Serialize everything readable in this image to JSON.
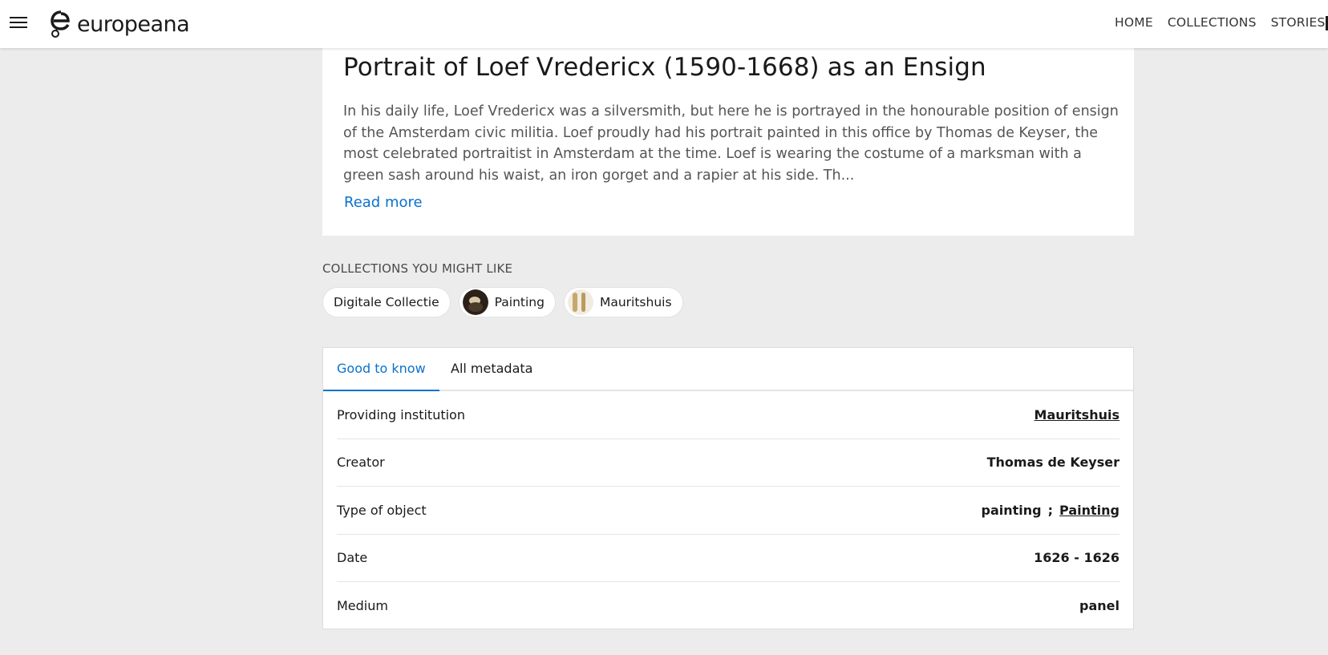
{
  "header": {
    "logo_text": "europeana",
    "nav": [
      "HOME",
      "COLLECTIONS",
      "STORIES"
    ]
  },
  "description": {
    "title": "Portrait of Loef Vredericx (1590-1668) as an Ensign",
    "text": "In his daily life, Loef Vredericx was a silversmith, but here he is portrayed in the honourable position of ensign of the Amsterdam civic militia. Loef proudly had his portrait painted in this office by Thomas de Keyser, the most celebrated portraitist in Amsterdam at the time. Loef is wearing the costume of a marksman with a green sash around his waist, an iron gorget and a rapier at his side. Th...",
    "read_more": "Read more"
  },
  "collections": {
    "heading": "COLLECTIONS YOU MIGHT LIKE",
    "chips": [
      "Digitale Collectie",
      "Painting",
      "Mauritshuis"
    ]
  },
  "metadata": {
    "tabs": [
      "Good to know",
      "All metadata"
    ],
    "rows": [
      {
        "label": "Providing institution",
        "value": "Mauritshuis"
      },
      {
        "label": "Creator",
        "value": "Thomas de Keyser"
      },
      {
        "label": "Type of object",
        "value_a": "painting",
        "separator": ";",
        "value_b": "Painting"
      },
      {
        "label": "Date",
        "value": "1626 - 1626"
      },
      {
        "label": "Medium",
        "value": "panel"
      }
    ]
  },
  "colors": {
    "accent": "#0a72cc",
    "background": "#ececec",
    "card": "#ffffff"
  }
}
